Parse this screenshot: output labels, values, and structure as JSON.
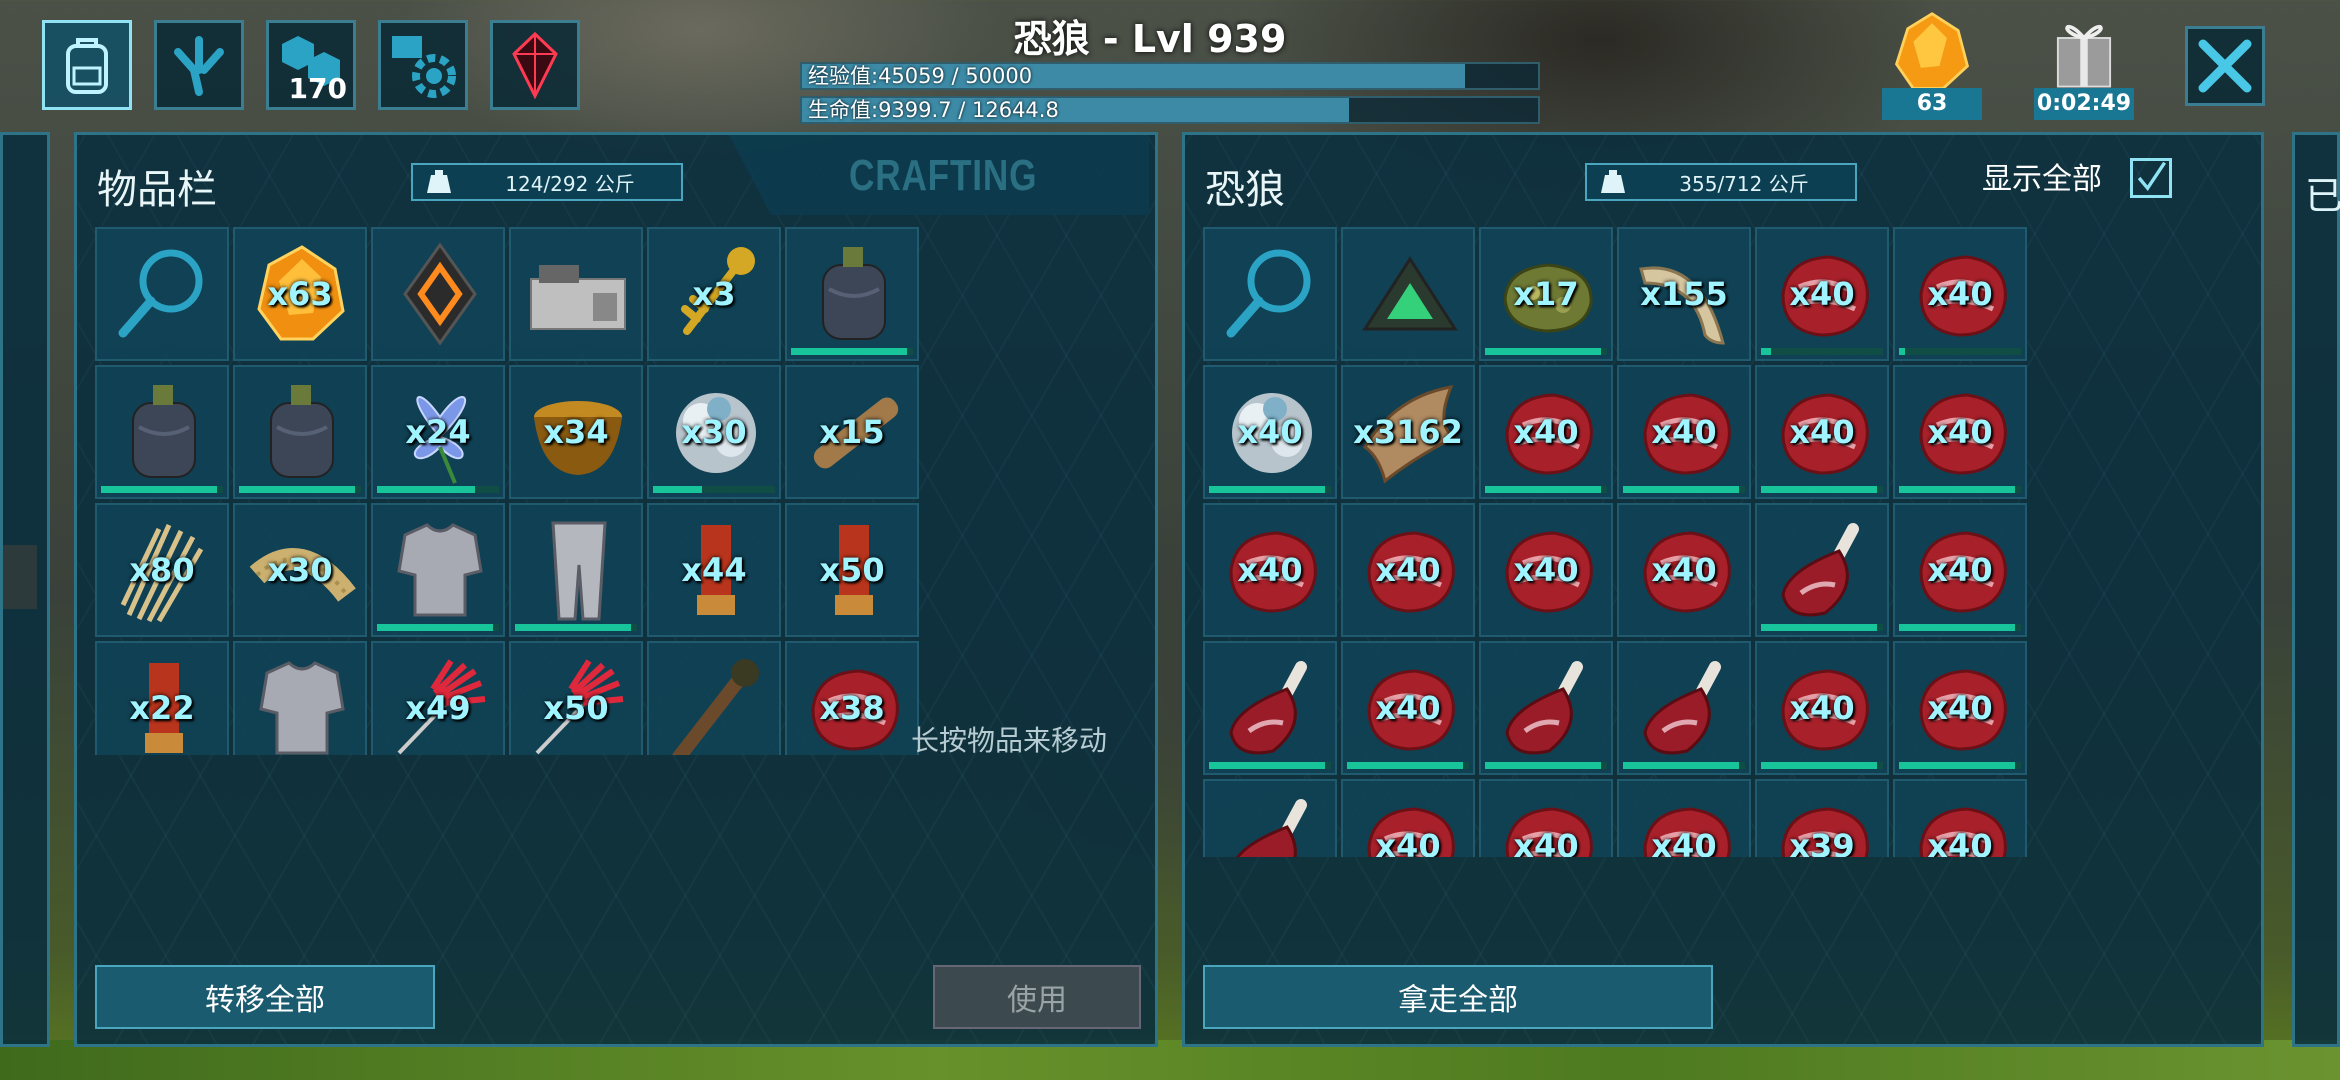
{
  "header": {
    "title": "恐狼 - Lvl 939",
    "xp_label": "经验值:45059 / 50000",
    "xp_fraction": 0.901,
    "hp_label": "生命值:9399.7 / 12644.8",
    "hp_fraction": 0.743,
    "element_count": "63",
    "gift_timer": "0:02:49",
    "tab_icons": [
      "backpack-icon",
      "dino-footprint-icon",
      "engram-icon",
      "settings-icon",
      "tek-crystal-icon"
    ],
    "engram_points": "170"
  },
  "inventory": {
    "title": "物品栏",
    "weight": "124/292 公斤",
    "crafting_label": "CRAFTING",
    "hint": "长按物品来移动",
    "transfer_all": "转移全部",
    "use": "使用",
    "items": [
      {
        "icon": "search-icon",
        "qty": ""
      },
      {
        "icon": "element-shard-icon",
        "qty": "x63"
      },
      {
        "icon": "tek-implant-icon",
        "qty": ""
      },
      {
        "icon": "smithy-icon",
        "qty": ""
      },
      {
        "icon": "key-icon",
        "qty": "x3"
      },
      {
        "icon": "canteen-icon",
        "qty": "",
        "dura": 0.95
      },
      {
        "icon": "canteen-icon",
        "qty": "",
        "dura": 0.95
      },
      {
        "icon": "canteen-icon",
        "qty": "",
        "dura": 0.95
      },
      {
        "icon": "flower-icon",
        "qty": "x24",
        "dura": 0.8
      },
      {
        "icon": "bowl-icon",
        "qty": "x34"
      },
      {
        "icon": "crystal-cluster-icon",
        "qty": "x30",
        "dura": 0.4
      },
      {
        "icon": "wood-icon",
        "qty": "x15"
      },
      {
        "icon": "thatch-icon",
        "qty": "x80"
      },
      {
        "icon": "fiber-icon",
        "qty": "x30"
      },
      {
        "icon": "chest-armor-icon",
        "qty": "",
        "dura": 0.95
      },
      {
        "icon": "leg-armor-icon",
        "qty": "",
        "dura": 0.95
      },
      {
        "icon": "shotgun-shell-icon",
        "qty": "x44"
      },
      {
        "icon": "shotgun-shell-icon",
        "qty": "x50"
      },
      {
        "icon": "shotgun-shell-icon",
        "qty": "x22"
      },
      {
        "icon": "chest-armor-icon",
        "qty": ""
      },
      {
        "icon": "tranq-dart-icon",
        "qty": "x49"
      },
      {
        "icon": "tranq-dart-icon",
        "qty": "x50"
      },
      {
        "icon": "torch-icon",
        "qty": ""
      },
      {
        "icon": "raw-meat-icon",
        "qty": "x38"
      }
    ]
  },
  "dino": {
    "title": "恐狼",
    "weight": "355/712 公斤",
    "show_all_label": "显示全部",
    "show_all_checked": true,
    "take_all": "拿走全部",
    "items": [
      {
        "icon": "search-icon",
        "qty": ""
      },
      {
        "icon": "tek-triangle-icon",
        "qty": ""
      },
      {
        "icon": "spoiled-meat-icon",
        "qty": "x17",
        "dura": 0.95
      },
      {
        "icon": "tusk-icon",
        "qty": "x155"
      },
      {
        "icon": "raw-meat-icon",
        "qty": "x40",
        "dura": 0.08
      },
      {
        "icon": "raw-meat-icon",
        "qty": "x40",
        "dura": 0.05
      },
      {
        "icon": "crystal-cluster-icon",
        "qty": "x40",
        "dura": 0.95
      },
      {
        "icon": "hide-icon",
        "qty": "x3162"
      },
      {
        "icon": "raw-meat-icon",
        "qty": "x40",
        "dura": 0.95
      },
      {
        "icon": "raw-meat-icon",
        "qty": "x40",
        "dura": 0.95
      },
      {
        "icon": "raw-meat-icon",
        "qty": "x40",
        "dura": 0.95
      },
      {
        "icon": "raw-meat-icon",
        "qty": "x40",
        "dura": 0.95
      },
      {
        "icon": "raw-meat-icon",
        "qty": "x40"
      },
      {
        "icon": "raw-meat-icon",
        "qty": "x40"
      },
      {
        "icon": "raw-meat-icon",
        "qty": "x40"
      },
      {
        "icon": "raw-meat-icon",
        "qty": "x40"
      },
      {
        "icon": "mutton-leg-icon",
        "qty": "",
        "dura": 0.95
      },
      {
        "icon": "raw-meat-icon",
        "qty": "x40",
        "dura": 0.95
      },
      {
        "icon": "mutton-leg-icon",
        "qty": "",
        "dura": 0.95
      },
      {
        "icon": "raw-meat-icon",
        "qty": "x40",
        "dura": 0.95
      },
      {
        "icon": "mutton-leg-icon",
        "qty": "",
        "dura": 0.95
      },
      {
        "icon": "mutton-leg-icon",
        "qty": "",
        "dura": 0.95
      },
      {
        "icon": "raw-meat-icon",
        "qty": "x40",
        "dura": 0.95
      },
      {
        "icon": "raw-meat-icon",
        "qty": "x40",
        "dura": 0.95
      },
      {
        "icon": "mutton-leg-icon",
        "qty": ""
      },
      {
        "icon": "raw-meat-icon",
        "qty": "x40"
      },
      {
        "icon": "raw-meat-icon",
        "qty": "x40"
      },
      {
        "icon": "raw-meat-icon",
        "qty": "x40"
      },
      {
        "icon": "raw-meat-icon",
        "qty": "x39"
      },
      {
        "icon": "raw-meat-icon",
        "qty": "x40"
      }
    ]
  },
  "right_strip_label": "已"
}
